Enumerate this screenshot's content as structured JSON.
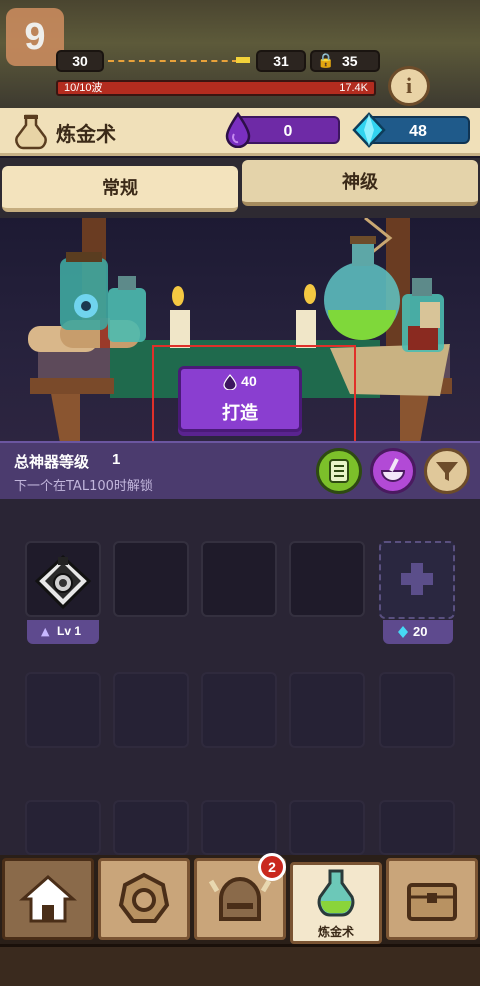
{
  "status": {
    "stage_number": "9",
    "current_level": "30",
    "next_level": "31",
    "locked_level": "35",
    "wave_text": "10/10波",
    "wave_value": "17.4K",
    "wave_progress": 1.0
  },
  "header": {
    "title": "炼金术",
    "purple_currency": "0",
    "gem_currency": "48"
  },
  "tabs": [
    {
      "label": "常规",
      "active": true
    },
    {
      "label": "神级",
      "active": false
    }
  ],
  "craft": {
    "cost": "40",
    "label": "打造"
  },
  "artifact_info": {
    "title": "总神器等级",
    "level": "1",
    "subtitle": "下一个在TAL100时解锁"
  },
  "artifacts": [
    {
      "level_label": "Lv 1",
      "icon": "bomb-potion-icon"
    }
  ],
  "unlock_slot": {
    "cost": "20"
  },
  "nav": {
    "items": [
      {
        "name": "home",
        "icon": "home-icon"
      },
      {
        "name": "gear",
        "icon": "gear-icon"
      },
      {
        "name": "hero",
        "icon": "helmet-icon",
        "badge": "2"
      },
      {
        "name": "alchemy",
        "icon": "potion-icon",
        "label": "炼金术",
        "active": true
      },
      {
        "name": "chest",
        "icon": "chest-icon"
      }
    ]
  },
  "colors": {
    "accent_purple": "#8b3fd0",
    "gem_blue": "#2ab7e6",
    "highlight_red": "#e0302a"
  }
}
